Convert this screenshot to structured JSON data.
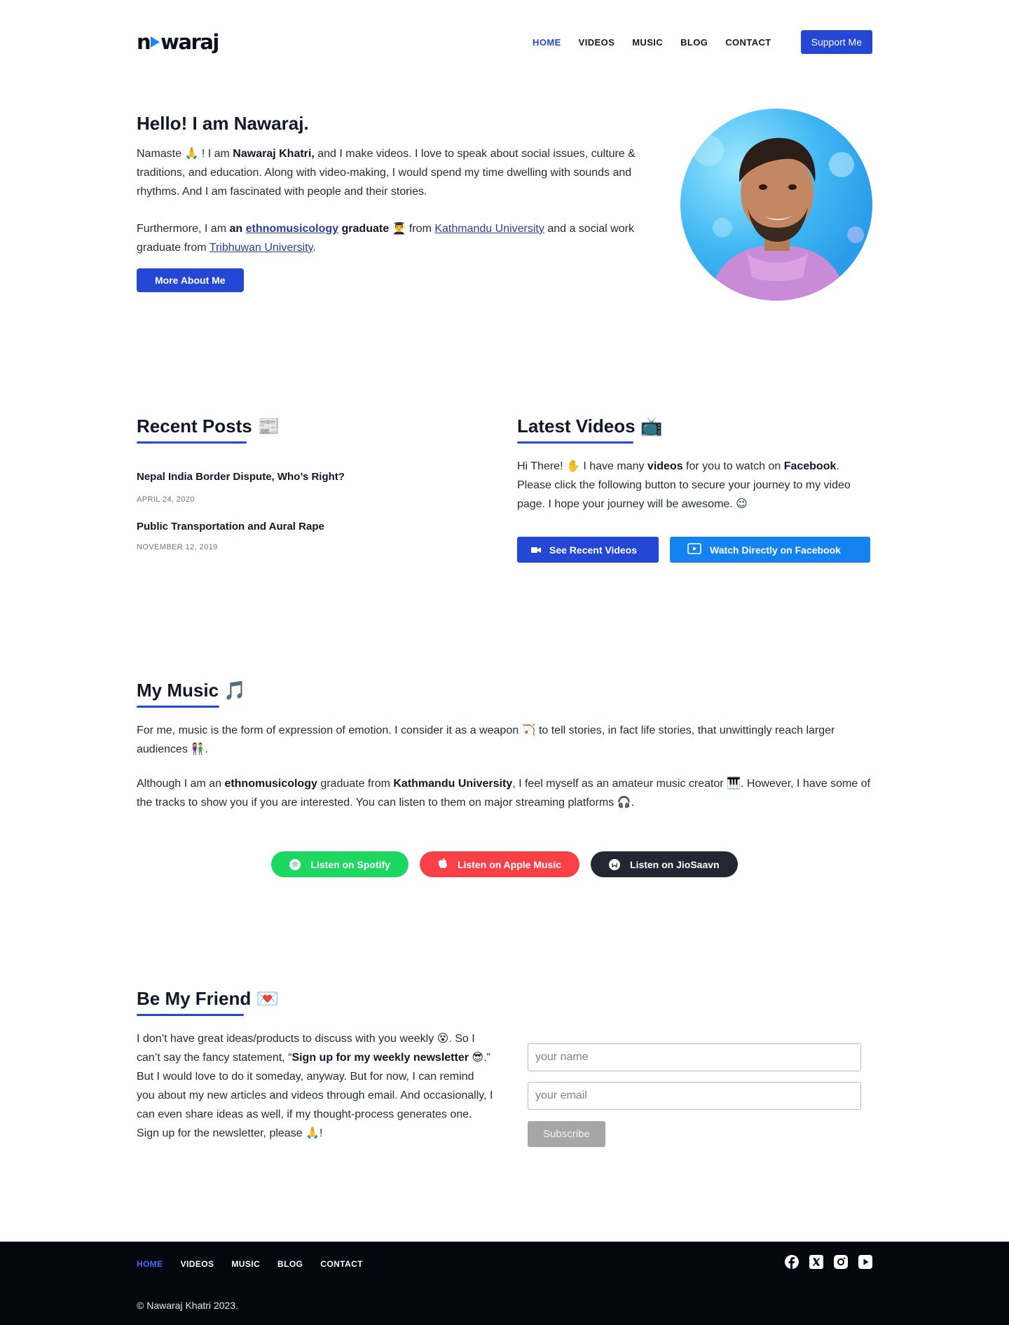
{
  "header": {
    "logo": "nawaraj",
    "nav": [
      "HOME",
      "VIDEOS",
      "MUSIC",
      "BLOG",
      "CONTACT"
    ],
    "support": "Support Me"
  },
  "hero": {
    "title": "Hello! I am Nawaraj.",
    "p1_a": "Namaste 🙏 ! I am ",
    "p1_name": "Nawaraj Khatri,",
    "p1_b": " and I make videos. I love to speak about social issues, culture & traditions, and education. Along with video-making, I would spend my time dwelling with sounds and rhythms. And I am fascinated with people and their stories.",
    "p2_a": "Furthermore, I am ",
    "p2_an": "an",
    "p2_ethno": "ethnomusicology",
    "p2_grad": "graduate",
    "p2_b": " 👨‍🎓 from ",
    "p2_ku": "Kathmandu University",
    "p2_c": " and a social work graduate from ",
    "p2_tu": "Tribhuwan University",
    "p2_d": ".",
    "button": "More About Me"
  },
  "posts": {
    "title": "Recent Posts 📰",
    "items": [
      {
        "title": "Nepal India Border Dispute, Who’s Right?",
        "date": "APRIL 24, 2020"
      },
      {
        "title": "Public Transportation and Aural Rape",
        "date": "NOVEMBER 12, 2019"
      }
    ]
  },
  "videos": {
    "title": "Latest Videos 📺",
    "p_a": "Hi There! ✋ I have many ",
    "p_videos": "videos",
    "p_b": " for you to watch on ",
    "p_fb": "Facebook",
    "p_c": ". Please click the following button to secure your journey to my video page. I hope your journey will be awesome. 😉",
    "btn_recent": "See Recent Videos",
    "btn_fb": "Watch Directly on Facebook"
  },
  "music": {
    "title": "My Music 🎵",
    "p1": "For me, music is the form of expression of emotion. I consider it as a weapon 🏹 to tell stories, in fact life stories, that unwittingly reach larger audiences 👫.",
    "p2_a": "Although I am an ",
    "p2_ethno": "ethnomusicology",
    "p2_b": " graduate from ",
    "p2_ku": "Kathmandu University",
    "p2_c": ", I feel myself as an amateur music creator 🎹. However, I have some of the tracks to show you if you are interested. You can listen to them on major streaming platforms 🎧.",
    "spotify": "Listen on Spotify",
    "apple": "Listen on Apple Music",
    "saavn": "Listen on JioSaavn"
  },
  "friend": {
    "title": "Be My Friend 💌",
    "p_a": "I don’t have great ideas/products to discuss with you weekly 😵. So I can’t say the fancy statement, “",
    "p_bold": "Sign up for my weekly newsletter",
    "p_b": " 😎.” But I would love to do it someday, anyway. But for now, I can remind you about my new articles and videos through email. And occasionally, I can even share ideas as well, if my thought-process generates one. Sign up for the newsletter, please 🙏!",
    "name_placeholder": "your name",
    "email_placeholder": "your email",
    "subscribe": "Subscribe"
  },
  "footer": {
    "nav": [
      "HOME",
      "VIDEOS",
      "MUSIC",
      "BLOG",
      "CONTACT"
    ],
    "social": [
      "facebook-icon",
      "x-icon",
      "instagram-icon",
      "youtube-icon"
    ],
    "copyright": "© Nawaraj Khatri 2023."
  },
  "colors": {
    "primary": "#2447d5",
    "facebook": "#1483f0",
    "spotify": "#1ed760",
    "apple": "#fa4047",
    "saavn": "#222732",
    "footer": "#05070e"
  }
}
